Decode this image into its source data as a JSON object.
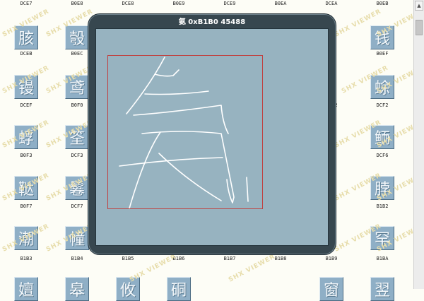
{
  "viewer": {
    "title": "氨 0xB1B0 45488",
    "glyph": "氨"
  },
  "grid": {
    "top_codes": [
      "DCE7",
      "B0E8",
      "DCE8",
      "B0E9",
      "DCE9",
      "B0EA",
      "DCEA",
      "B0EB"
    ],
    "rows": [
      {
        "chars": [
          "胲",
          "彀",
          "",
          "",
          "",
          "",
          "",
          "钱"
        ],
        "codes": [
          "DCEB",
          "B0EC",
          "",
          "",
          "",
          "",
          "",
          "B0EF"
        ]
      },
      {
        "chars": [
          "镘",
          "鸢",
          "",
          "",
          "",
          "",
          "",
          "蜍"
        ],
        "codes": [
          "DCEF",
          "B0F0",
          "",
          "",
          "",
          "",
          "DCF2",
          "DCF2"
        ]
      },
      {
        "chars": [
          "蜉",
          "筌",
          "",
          "",
          "",
          "",
          "",
          "鲕"
        ],
        "codes": [
          "B0F3",
          "DCF3",
          "",
          "",
          "",
          "",
          "",
          "DCF6"
        ]
      },
      {
        "chars": [
          "鞑",
          "鬈",
          "",
          "",
          "",
          "",
          "",
          "脖"
        ],
        "codes": [
          "B0F7",
          "DCF7",
          "",
          "",
          "",
          "",
          "B1",
          "B1B2"
        ]
      },
      {
        "chars": [
          "潮",
          "幢",
          "",
          "",
          "",
          "",
          "",
          "罕"
        ],
        "codes": [
          "B1B3",
          "B1B4",
          "B1B5",
          "B1B6",
          "B1B7",
          "B1B8",
          "B1B9",
          "B1BA"
        ]
      }
    ],
    "bottom_partial_chars": [
      "嬗",
      "皋",
      "攸",
      "硐",
      "",
      "",
      "窗",
      "翌"
    ]
  },
  "watermark": "SHX VIEWER"
}
